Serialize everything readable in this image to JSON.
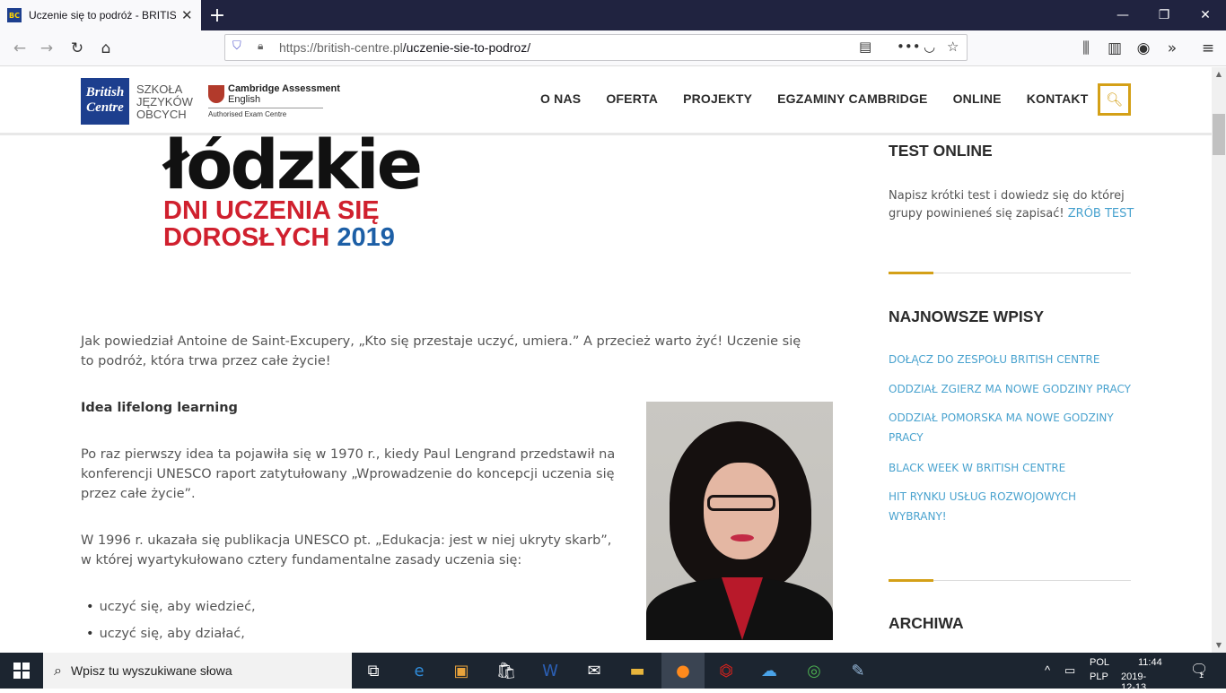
{
  "browser": {
    "tab_title": "Uczenie się to podróż - BRITISH CENTRE",
    "tab_favicon_text": "BC",
    "url_host": "https://british-centre.pl",
    "url_path": "/uczenie-sie-to-podroz/",
    "url_full": "https://british-centre.pl/uczenie-sie-to-podroz/"
  },
  "site": {
    "logo_main": "British Centre",
    "logo_sub": [
      "SZKOŁA",
      "JĘZYKÓW",
      "OBCYCH"
    ],
    "cambridge_line1": "Cambridge Assessment",
    "cambridge_line2": "English",
    "cambridge_line3": "Authorised Exam Centre",
    "nav": [
      "O NAS",
      "OFERTA",
      "PROJEKTY",
      "EGZAMINY CAMBRIDGE",
      "ONLINE",
      "KONTAKT"
    ]
  },
  "article": {
    "banner_word": "łódzkie",
    "banner_line1": "DNI UCZENIA SIĘ",
    "banner_line2": "DOROSŁYCH",
    "banner_year": "2019",
    "intro": "Jak powiedział Antoine de Saint-Excupery, „Kto się przestaje uczyć, umiera.” A przecież warto żyć! Uczenie się to podróż, która trwa przez całe życie!",
    "heading": "Idea lifelong learning",
    "p1": "Po raz pierwszy idea ta pojawiła się w 1970 r., kiedy Paul Lengrand przedstawił na konferencji UNESCO raport zatytułowany „Wprowadzenie do koncepcji uczenia się przez całe życie”.",
    "p2": "W 1996 r. ukazała się publikacja UNESCO pt. „Edukacja: jest w niej ukryty skarb”, w której wyartykułowano cztery fundamentalne zasady uczenia się:",
    "bullets": [
      "uczyć się, aby wiedzieć,",
      "uczyć się, aby działać,"
    ]
  },
  "sidebar": {
    "test_title": "TEST ONLINE",
    "test_text": "Napisz krótki test i dowiedz się do której grupy powinieneś się zapisać!",
    "test_link": "ZRÓB TEST",
    "latest_title": "NAJNOWSZE WPISY",
    "latest": [
      "DOŁĄCZ DO ZESPOŁU BRITISH CENTRE",
      "ODDZIAŁ ZGIERZ MA NOWE GODZINY PRACY",
      "ODDZIAŁ POMORSKA MA NOWE GODZINY PRACY",
      "BLACK WEEK W BRITISH CENTRE",
      "HIT RYNKU USŁUG ROZWOJOWYCH WYBRANY!"
    ],
    "archive_title": "ARCHIWA"
  },
  "taskbar": {
    "search_placeholder": "Wpisz tu wyszukiwane słowa",
    "lang1": "POL",
    "lang2": "PLP",
    "time": "11:44",
    "date": "2019-12-13",
    "notif_count": "1"
  },
  "colors": {
    "accent": "#d4a017",
    "link": "#4aa3cf",
    "banner_red": "#d0202e",
    "banner_blue": "#1d5fa6",
    "brand_blue": "#1d3f8e"
  }
}
